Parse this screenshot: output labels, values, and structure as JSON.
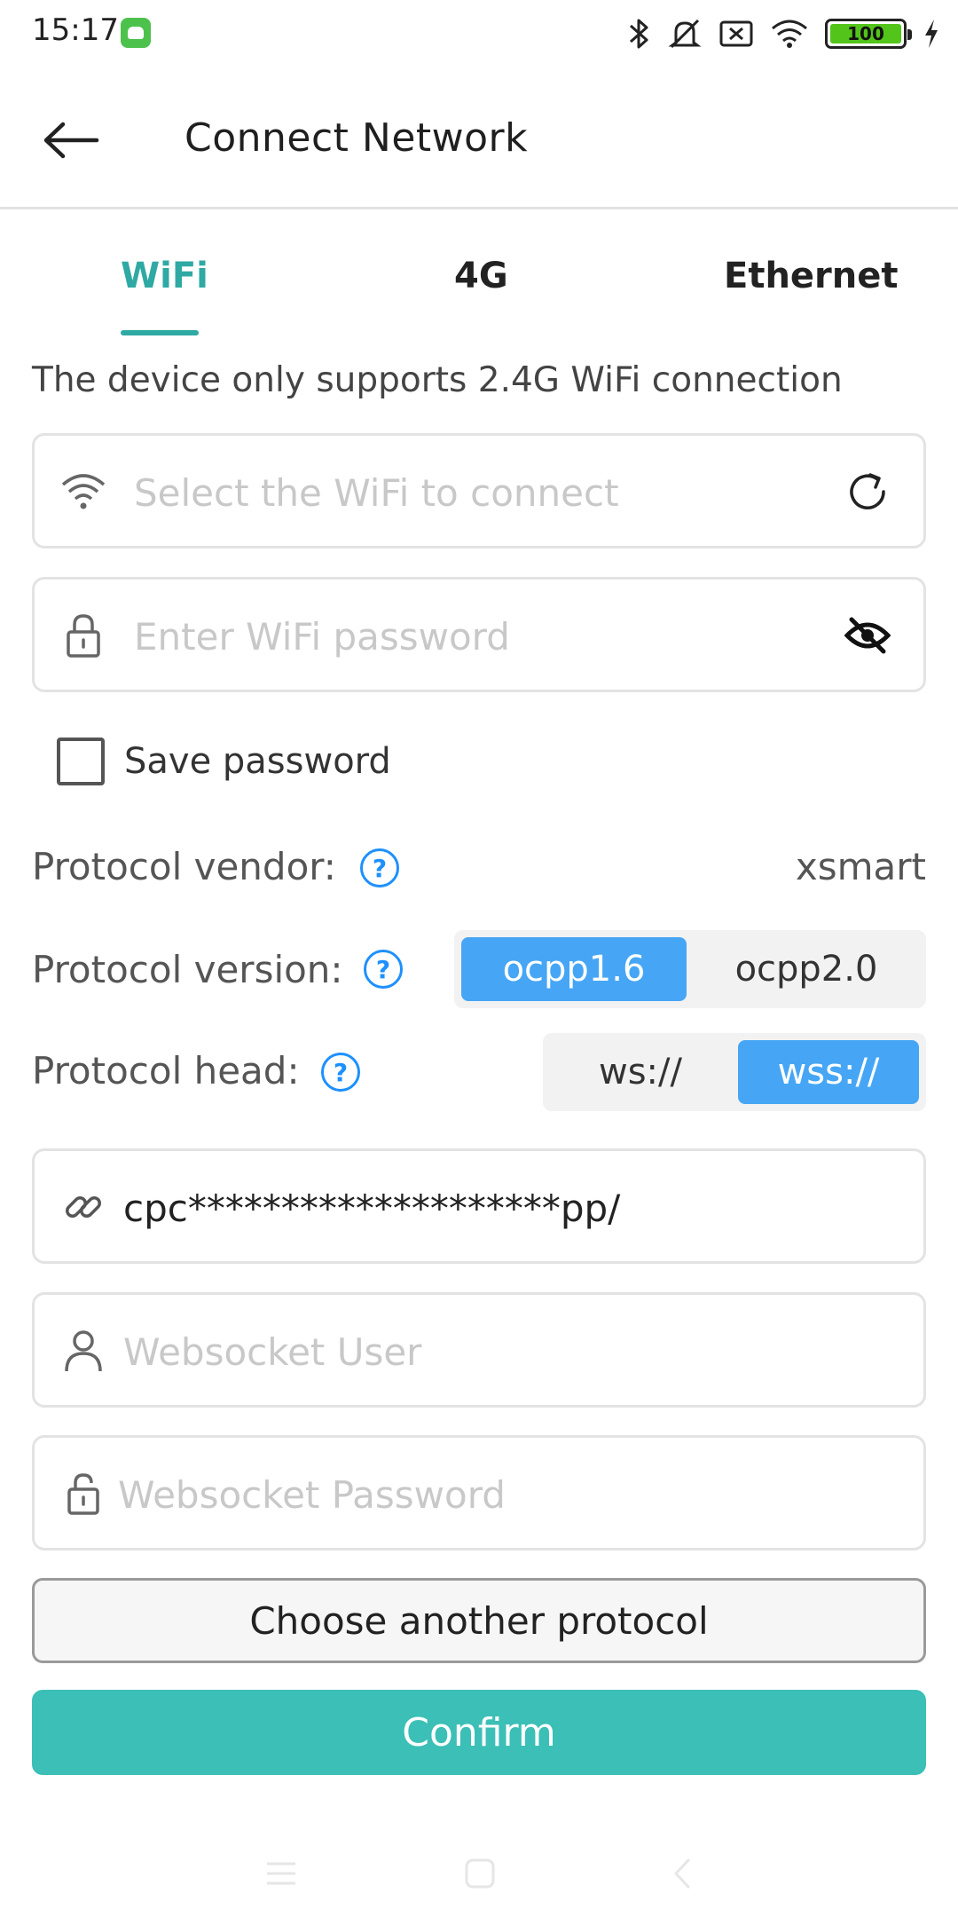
{
  "status_bar": {
    "time": "15:17",
    "battery_level": "100",
    "icons": [
      "app-notification-icon",
      "bluetooth-icon",
      "silent-icon",
      "sim-off-icon",
      "wifi-signal-icon",
      "battery-icon",
      "charging-icon"
    ]
  },
  "header": {
    "title": "Connect Network",
    "back_icon": "back-arrow-icon"
  },
  "tabs": [
    {
      "label": "WiFi",
      "active": true
    },
    {
      "label": "4G",
      "active": false
    },
    {
      "label": "Ethernet",
      "active": false
    }
  ],
  "notice": "The device only supports 2.4G WiFi connection",
  "wifi_select": {
    "placeholder": "Select the WiFi to connect",
    "icon": "wifi-icon",
    "action_icon": "refresh-icon"
  },
  "wifi_password": {
    "placeholder": "Enter WiFi password",
    "icon": "lock-icon",
    "action_icon": "eye-hidden-icon"
  },
  "save_password": {
    "label": "Save password",
    "checked": false
  },
  "protocol_vendor": {
    "label": "Protocol vendor:",
    "value": "xsmart"
  },
  "protocol_version": {
    "label": "Protocol version:",
    "options": [
      "ocpp1.6",
      "ocpp2.0"
    ],
    "selected": "ocpp1.6"
  },
  "protocol_head": {
    "label": "Protocol head:",
    "options": [
      "ws://",
      "wss://"
    ],
    "selected": "wss://"
  },
  "server_url": {
    "value": "cpc********************pp/",
    "icon": "link-icon"
  },
  "ws_user": {
    "placeholder": "Websocket User",
    "icon": "user-icon"
  },
  "ws_password": {
    "placeholder": "Websocket Password",
    "icon": "unlock-icon"
  },
  "buttons": {
    "another_protocol": "Choose another protocol",
    "confirm": "Confirm"
  },
  "colors": {
    "accent": "#2fa9a3",
    "confirm_bg": "#3bbfb6",
    "segment_active": "#46a6f5",
    "help": "#1e90ff"
  }
}
